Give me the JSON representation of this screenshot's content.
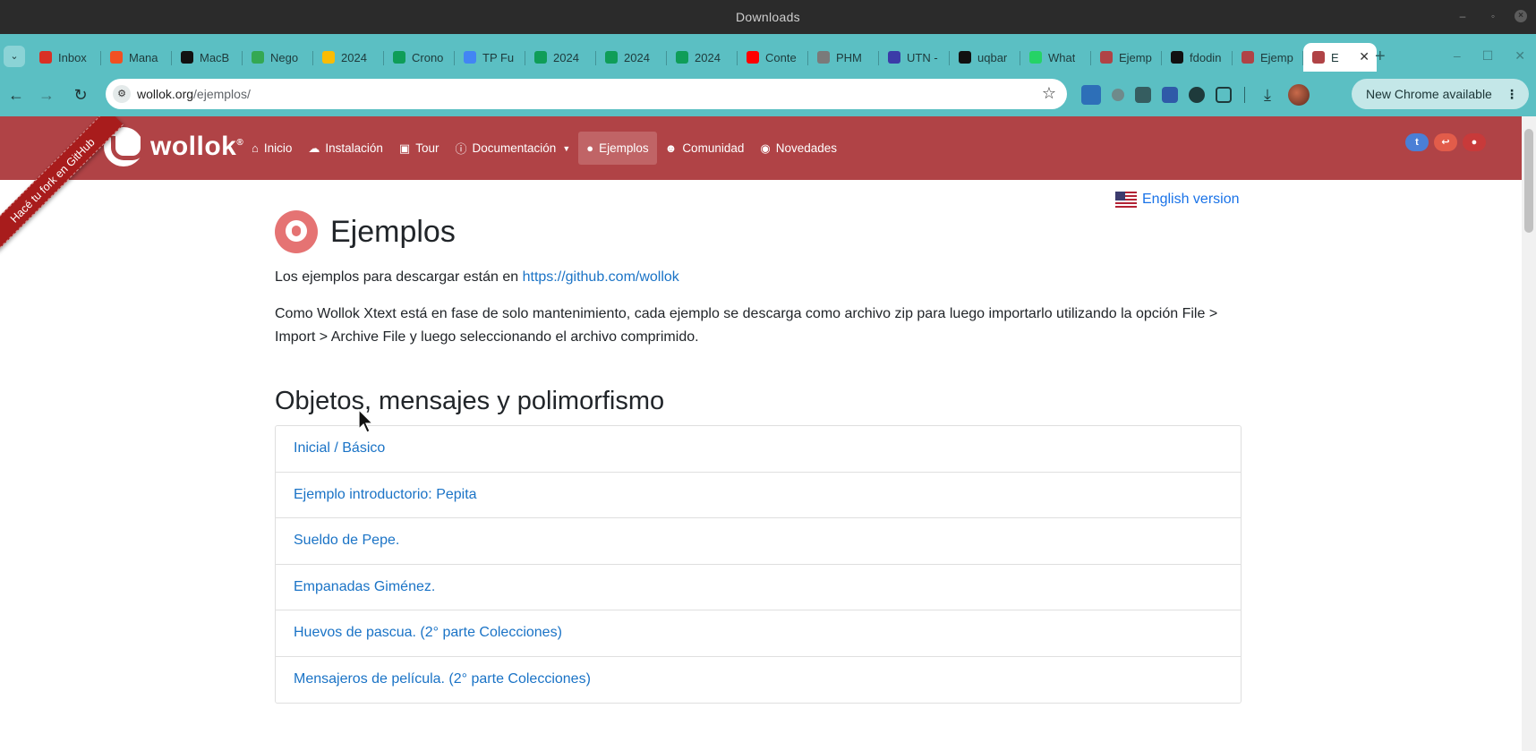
{
  "os": {
    "title": "Downloads"
  },
  "tabs": [
    {
      "label": "Inbox",
      "icon": "gmail-icon",
      "color": "#d93025"
    },
    {
      "label": "Mana",
      "icon": "microsoft-icon",
      "color": "#f25022"
    },
    {
      "label": "MacB",
      "icon": "apple-icon",
      "color": "#111111"
    },
    {
      "label": "Nego",
      "icon": "maps-icon",
      "color": "#34a853"
    },
    {
      "label": "2024",
      "icon": "drive-icon",
      "color": "#fbbc04"
    },
    {
      "label": "Crono",
      "icon": "sheets-icon",
      "color": "#0f9d58"
    },
    {
      "label": "TP Fu",
      "icon": "docs-icon",
      "color": "#4285f4"
    },
    {
      "label": "2024",
      "icon": "sheets-icon",
      "color": "#0f9d58"
    },
    {
      "label": "2024",
      "icon": "sheets-icon",
      "color": "#0f9d58"
    },
    {
      "label": "2024",
      "icon": "sheets-icon",
      "color": "#0f9d58"
    },
    {
      "label": "Conte",
      "icon": "youtube-icon",
      "color": "#ff0000"
    },
    {
      "label": "PHM",
      "icon": "document-icon",
      "color": "#7a7a7a"
    },
    {
      "label": "UTN -",
      "icon": "utn-icon",
      "color": "#3b3ba8"
    },
    {
      "label": "uqbar",
      "icon": "github-icon",
      "color": "#111111"
    },
    {
      "label": "What",
      "icon": "whatsapp-icon",
      "color": "#25d366"
    },
    {
      "label": "Ejemp",
      "icon": "wollok-icon",
      "color": "#b04346"
    },
    {
      "label": "fdodin",
      "icon": "github-icon",
      "color": "#111111"
    },
    {
      "label": "Ejemp",
      "icon": "wollok-icon",
      "color": "#b04346"
    },
    {
      "label": "E",
      "icon": "wollok-icon",
      "color": "#b04346",
      "active": true
    }
  ],
  "browser": {
    "url_host": "wollok.org",
    "url_path": "/ejemplos/",
    "update_label": "New Chrome available"
  },
  "site": {
    "logo_text": "wollok",
    "logo_reg": "®",
    "ribbon": "Hacé tu fork en GitHub",
    "nav": [
      {
        "label": "Inicio",
        "icon": "home-icon",
        "glyph": "⌂"
      },
      {
        "label": "Instalación",
        "icon": "cloud-download-icon",
        "glyph": "☁"
      },
      {
        "label": "Tour",
        "icon": "bus-icon",
        "glyph": "▣"
      },
      {
        "label": "Documentación",
        "icon": "info-icon",
        "glyph": "ⓘ",
        "dropdown": true
      },
      {
        "label": "Ejemplos",
        "icon": "github-icon",
        "glyph": "●",
        "active": true
      },
      {
        "label": "Comunidad",
        "icon": "users-icon",
        "glyph": "☻"
      },
      {
        "label": "Novedades",
        "icon": "podcast-icon",
        "glyph": "◉"
      }
    ],
    "social": [
      {
        "icon": "twitter-icon",
        "glyph": "t",
        "color": "#4a7fd6"
      },
      {
        "icon": "reply-icon",
        "glyph": "↩",
        "color": "#e25c4a"
      },
      {
        "icon": "github-icon",
        "glyph": "●",
        "color": "#c83a3a"
      }
    ],
    "lang_label": "English version"
  },
  "content": {
    "title": "Ejemplos",
    "intro_text": "Los ejemplos para descargar están en ",
    "intro_link": "https://github.com/wollok",
    "paragraph": "Como Wollok Xtext está en fase de solo mantenimiento, cada ejemplo se descarga como archivo zip para luego importarlo utilizando la opción File > Import > Archive File y luego seleccionando el archivo comprimido.",
    "section_title": "Objetos, mensajes y polimorfismo",
    "examples": [
      "Inicial / Básico",
      "Ejemplo introductorio: Pepita",
      "Sueldo de Pepe.",
      "Empanadas Giménez.",
      "Huevos de pascua. (2° parte Colecciones)",
      "Mensajeros de película. (2° parte Colecciones)"
    ]
  }
}
